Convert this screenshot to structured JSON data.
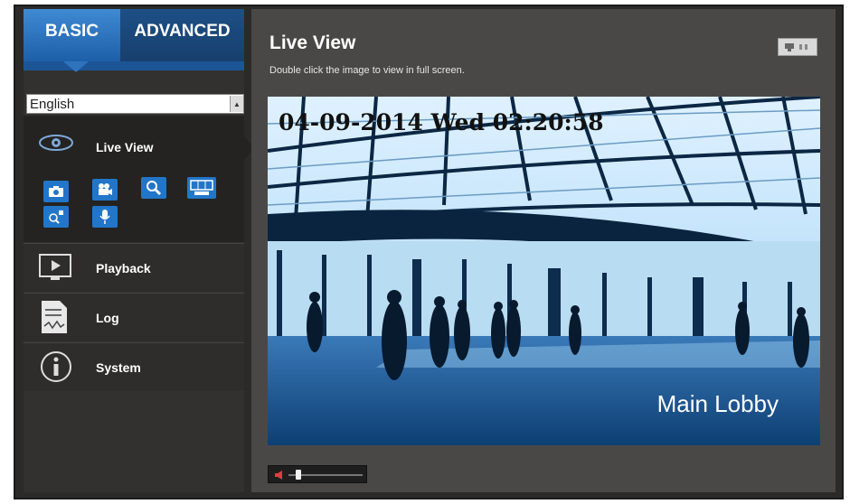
{
  "tabs": {
    "basic": "BASIC",
    "advanced": "ADVANCED"
  },
  "language": {
    "selected": "English"
  },
  "menu": {
    "live_view": "Live View",
    "playback": "Playback",
    "log": "Log",
    "system": "System"
  },
  "live_tools": [
    "snapshot-icon",
    "record-icon",
    "zoom-icon",
    "codec-icon",
    "digital-zoom-icon",
    "microphone-icon"
  ],
  "main": {
    "title": "Live View",
    "hint": "Double click the image to view in full screen.",
    "timestamp": "04-09-2014 Wed 02:20:58",
    "camera_name": "Main Lobby"
  },
  "colors": {
    "accent": "#2276c9",
    "tab_active": "#3f8ad3",
    "tab_inactive": "#1d4f86"
  }
}
